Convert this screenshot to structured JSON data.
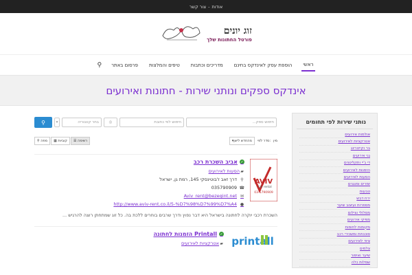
{
  "topbar": {
    "about": "אודות",
    "separator": "-",
    "contact": "צור קשר"
  },
  "header": {
    "title": "זוג יונים",
    "subtitle": "פורטל החתונות שלך"
  },
  "nav": {
    "items": [
      "ראשי",
      "הוספת עסק לאינדקס בחינם",
      "מדריכים וכתבות",
      "טיפים והמלצות",
      "פרסום באתר"
    ]
  },
  "banner": {
    "title": "אינדקס ספקים ונותני שירות - חתונות ואירועים"
  },
  "search": {
    "keyword_placeholder": "חיפוש ספק...",
    "location_placeholder": "חיפוש לפי כתובת",
    "category_placeholder": "בחר קטגוריה"
  },
  "toolbar": {
    "list_view": "רשימה",
    "grid_view": "קוביות",
    "map_view": "מפה",
    "sort_label": "סדר לפי:",
    "sort_value": "מהחדש לישן",
    "sort_extra": "מין"
  },
  "sidebar": {
    "title": "נותני שירות לפי תחומים",
    "items": [
      "אולמות אירועים",
      "אטרקציות לאירועים",
      "בר וקייטרינג",
      "גני אירועים",
      "די ג'יי ותקליטנים",
      "הזמנות לאירועים",
      "הסעות לאירועים",
      "זמרים ומנגנים",
      "טבעות",
      "ירח דבש",
      "מספרות ועיצוב שיער",
      "מסלולי וצילום",
      "מפיקי אירועים",
      "מקומות לחופות",
      "סוכנויות ומשכירי רכב",
      "ציוד לאירועים",
      "צלמים",
      "שיער ואיפור",
      "שמלות כלה"
    ]
  },
  "listings": [
    {
      "title": "אביב השכרת רכב",
      "category": "הסעות לאירועים",
      "address": "דרך זאב ז'בוטינסקי 145, רמת גן, ישראל",
      "phone": "035790909",
      "email": "Aviv_rent@bezeqint.net",
      "url": "http://www.aviv-rent.co.il/5-%D7%98%D7%99%D7%A4",
      "description": "השכרת רכבי יוקרה לחתונה בישראל היא דבר נפוץ ודרך שרבים בוחרים ללכת בה. כל זוג שמתחתן רוצה להרגיש ...",
      "logo_text": "AVIV",
      "logo_sub": "car rental",
      "logo_phone": "03-5790909"
    },
    {
      "title": "Printall הזמנות לחתונה",
      "category": "אטרקציות לאירועים",
      "logo_text": "printall"
    }
  ],
  "colors": {
    "accent": "#7b2fd0",
    "button": "#2b8cd1",
    "topbar": "#222222"
  }
}
